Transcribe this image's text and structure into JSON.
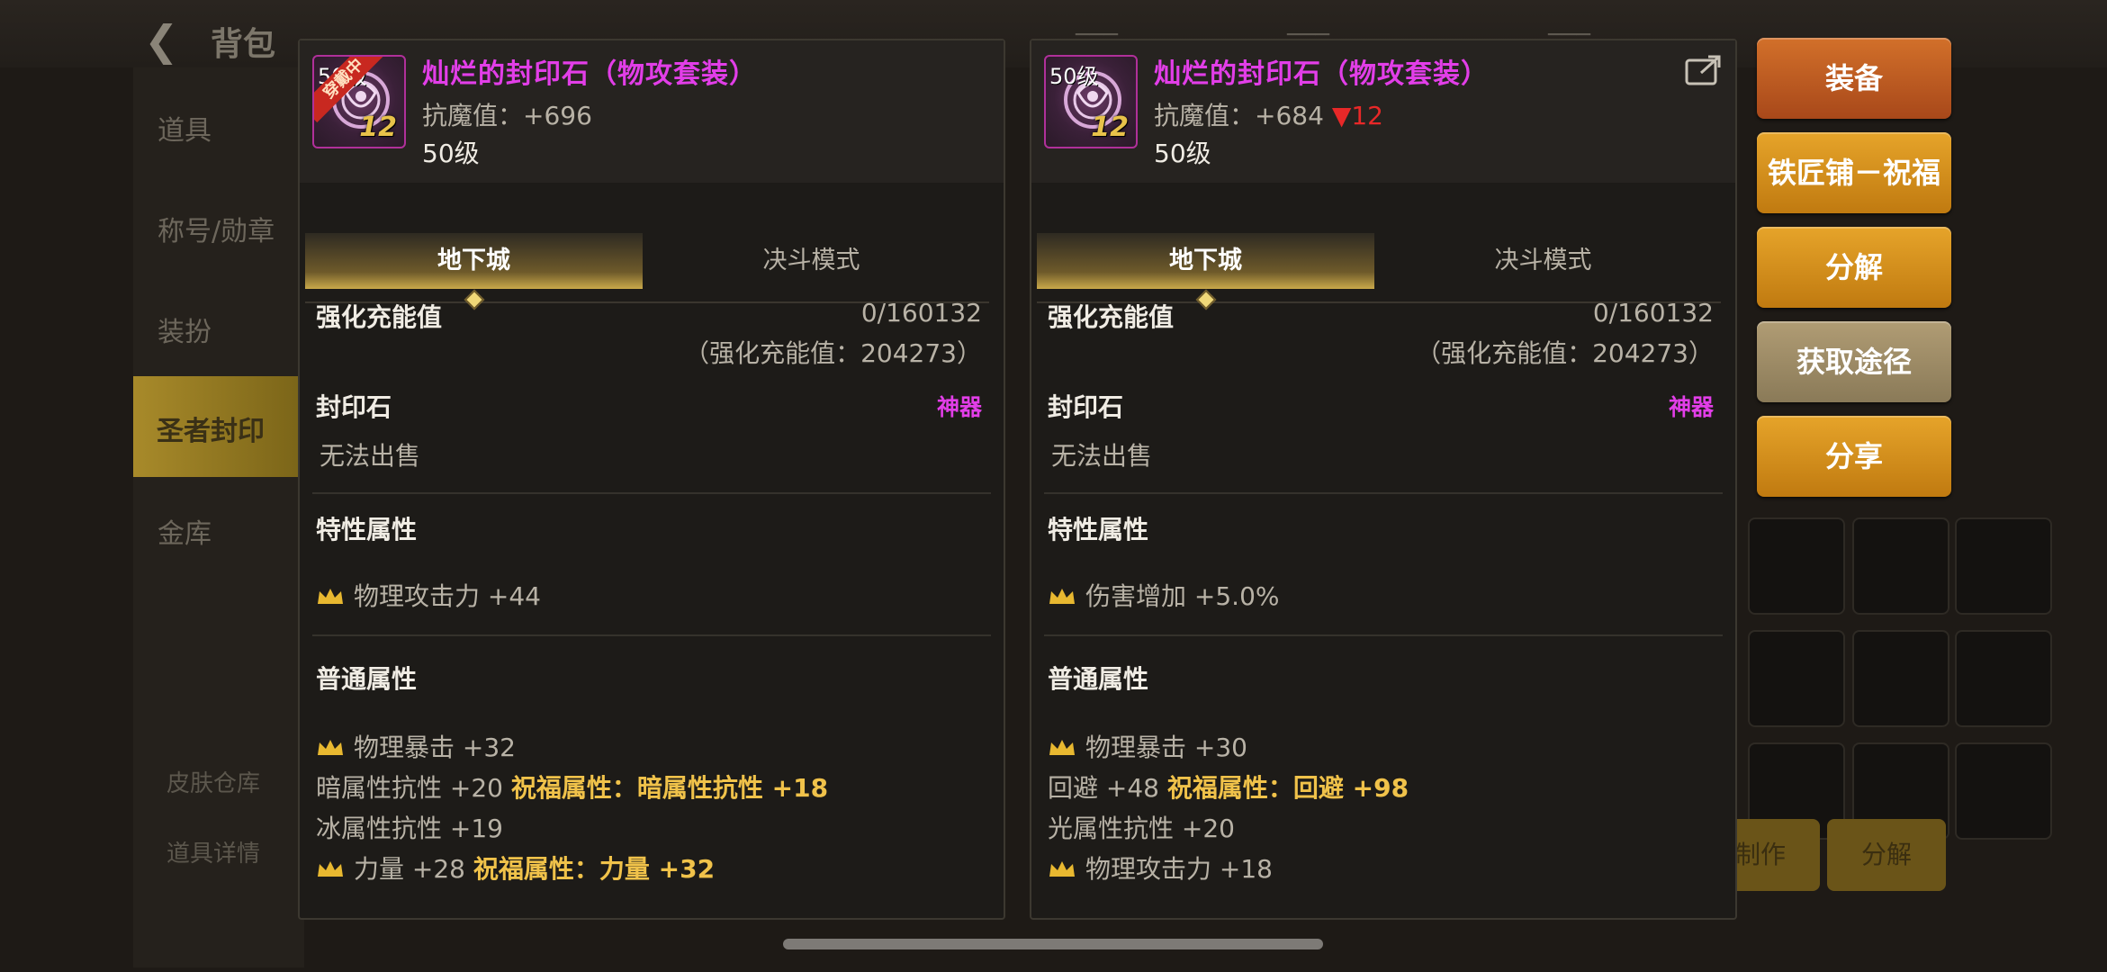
{
  "background": {
    "title": "背包",
    "sidebar_items": [
      "道具",
      "称号/勋章",
      "装扮",
      "圣者封印",
      "金库"
    ],
    "bottom_links": [
      "皮肤仓库",
      "道具详情"
    ],
    "bottom_buttons": [
      "制作",
      "分解"
    ]
  },
  "left_item": {
    "icon_label": "50级",
    "badge": "穿戴中",
    "icon_level": "12",
    "name": "灿烂的封印石（物攻套装）",
    "stat_label": "抗魔值：",
    "stat_value": "+696",
    "level": "50级",
    "tabs": [
      "地下城",
      "决斗模式"
    ],
    "charge_label": "强化充能值",
    "charge_value": "0/160132",
    "charge_sub": "（强化充能值：204273）",
    "type_label": "封印石",
    "rarity": "神器",
    "sell": "无法出售",
    "trait_title": "特性属性",
    "traits": [
      "物理攻击力 +44"
    ],
    "normal_title": "普通属性",
    "normal_stats": [
      {
        "crown": true,
        "text": "物理暴击 +32",
        "bless": ""
      },
      {
        "crown": false,
        "text": "暗属性抗性 +20",
        "bless": "祝福属性：暗属性抗性 +18"
      },
      {
        "crown": false,
        "text": "冰属性抗性 +19",
        "bless": ""
      },
      {
        "crown": true,
        "text": "力量 +28",
        "bless": "祝福属性：力量 +32"
      }
    ]
  },
  "right_item": {
    "icon_label": "50级",
    "icon_level": "12",
    "name": "灿烂的封印石（物攻套装）",
    "stat_label": "抗魔值：",
    "stat_value": "+684",
    "stat_diff": "▼12",
    "level": "50级",
    "tabs": [
      "地下城",
      "决斗模式"
    ],
    "charge_label": "强化充能值",
    "charge_value": "0/160132",
    "charge_sub": "（强化充能值：204273）",
    "type_label": "封印石",
    "rarity": "神器",
    "sell": "无法出售",
    "trait_title": "特性属性",
    "traits": [
      "伤害增加 +5.0%"
    ],
    "normal_title": "普通属性",
    "normal_stats": [
      {
        "crown": true,
        "text": "物理暴击 +30",
        "bless": ""
      },
      {
        "crown": false,
        "text": "回避 +48",
        "bless": "祝福属性：回避 +98"
      },
      {
        "crown": false,
        "text": "光属性抗性 +20",
        "bless": ""
      },
      {
        "crown": true,
        "text": "物理攻击力 +18",
        "bless": ""
      }
    ]
  },
  "actions": {
    "equip": "装备",
    "blacksmith": "铁匠铺－祝福",
    "disassemble": "分解",
    "source": "获取途径",
    "share": "分享"
  },
  "colors": {
    "item_name": "#e23ee8",
    "bless": "#f0c24a",
    "diff_down": "#e82828",
    "equip_button": "#c05e22",
    "gold_button": "#d8901a",
    "grey_button": "#a08c64"
  }
}
